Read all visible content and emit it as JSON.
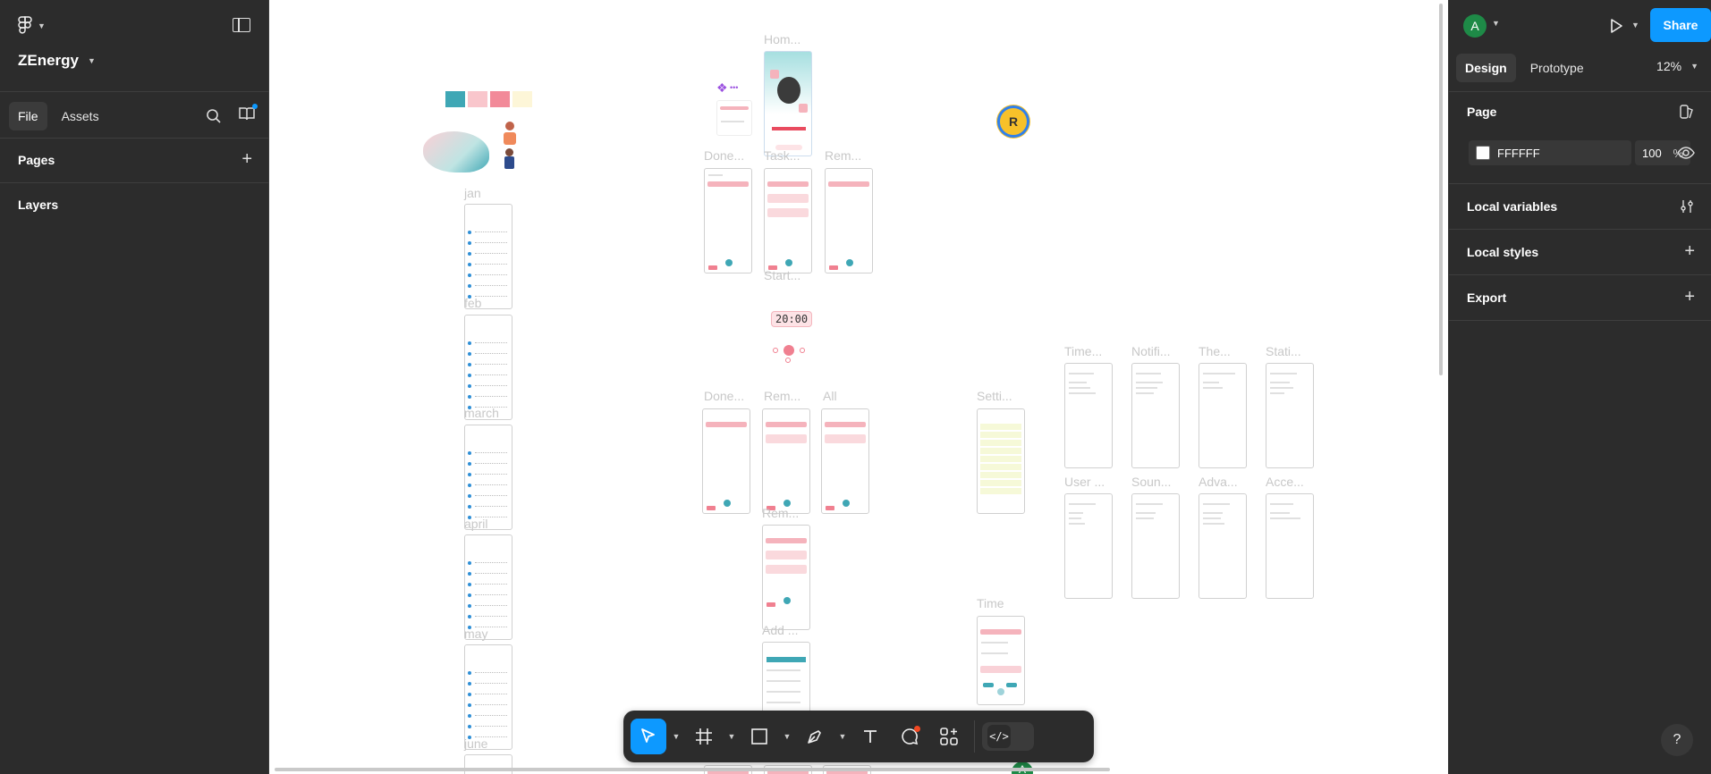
{
  "app": {
    "project_name": "ZEnergy"
  },
  "left_panel": {
    "tabs": [
      {
        "label": "File"
      },
      {
        "label": "Assets"
      }
    ],
    "pages_title": "Pages",
    "layers_title": "Layers"
  },
  "canvas": {
    "frame_labels": {
      "home": "Hom...",
      "done1": "Done...",
      "task": "Task...",
      "rem1": "Rem...",
      "start": "Start...",
      "jan": "jan",
      "feb": "feb",
      "march": "march",
      "april": "april",
      "may": "may",
      "june": "june",
      "done2": "Done...",
      "rem2": "Rem...",
      "all": "All",
      "rem3": "Rem...",
      "add": "Add ...",
      "setti": "Setti...",
      "time_short": "Time...",
      "notifi": "Notifi...",
      "the": "The...",
      "stati": "Stati...",
      "user": "User ...",
      "soun": "Soun...",
      "adva": "Adva...",
      "acce": "Acce...",
      "time": "Time"
    },
    "timer_text": "20:00",
    "cursor_user_initial": "R",
    "bottom_user_initial": "A",
    "swatch_colors": [
      "#3fa7b5",
      "#f9c6cc",
      "#f28a99",
      "#fdf6d8"
    ]
  },
  "toolbar": {
    "tools": [
      "move-tool",
      "frame-tool",
      "shape-tool",
      "pen-tool",
      "text-tool",
      "comment-tool",
      "actions-tool"
    ],
    "dev_mode_label": "</>"
  },
  "right_panel": {
    "user_initial": "A",
    "share_label": "Share",
    "tabs": [
      {
        "label": "Design"
      },
      {
        "label": "Prototype"
      }
    ],
    "zoom": "12%",
    "page_title": "Page",
    "page_color": "FFFFFF",
    "page_opacity": "100",
    "percent_sign": "%",
    "local_variables": "Local variables",
    "local_styles": "Local styles",
    "export": "Export"
  },
  "colors": {
    "accent": "#0d99ff",
    "panel_bg": "#2c2c2c"
  }
}
